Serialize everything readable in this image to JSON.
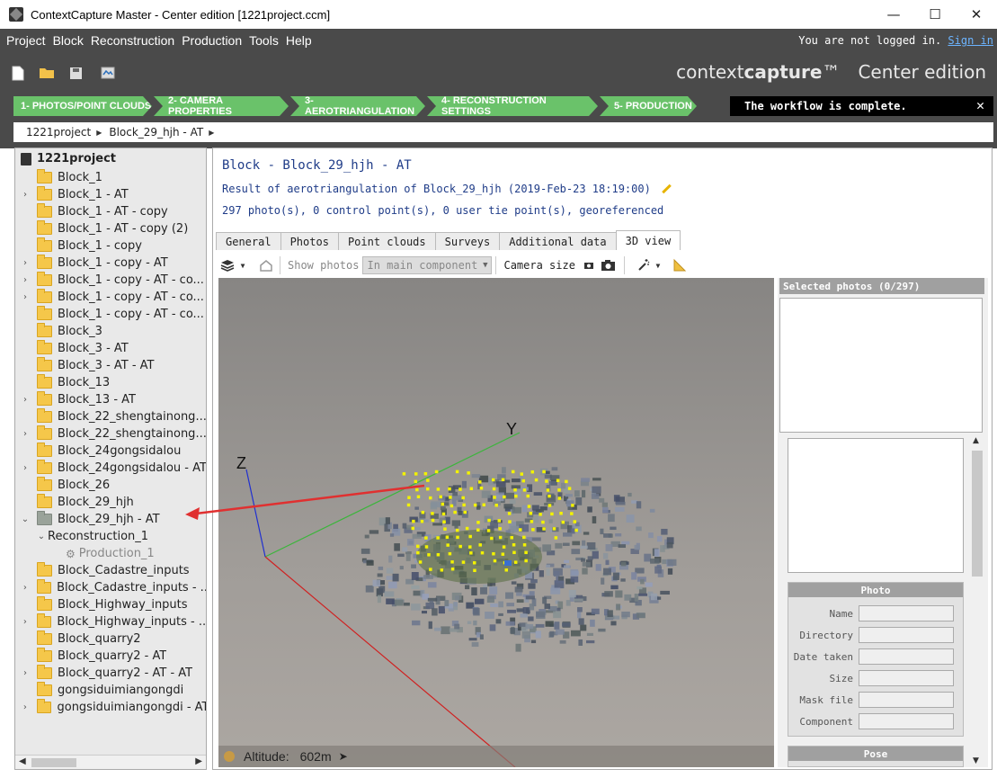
{
  "window": {
    "title": "ContextCapture Master - Center edition [1221project.ccm]",
    "controls": [
      "—",
      "☐",
      "✕"
    ]
  },
  "menu": [
    "Project",
    "Block",
    "Reconstruction",
    "Production",
    "Tools",
    "Help"
  ],
  "login": {
    "text": "You are not logged in.",
    "link": "Sign in"
  },
  "brand": {
    "name_light": "context",
    "name_bold": "capture",
    "tm": "™",
    "edition": "Center edition"
  },
  "workflow": {
    "steps": [
      "1- PHOTOS/POINT CLOUDS",
      "2- CAMERA PROPERTIES",
      "3- AEROTRIANGULATION",
      "4- RECONSTRUCTION SETTINGS",
      "5- PRODUCTION"
    ],
    "message": "The workflow is complete.",
    "close": "✕"
  },
  "breadcrumb": [
    "1221project",
    "Block_29_hjh - AT"
  ],
  "tree": {
    "root": "1221project",
    "items": [
      {
        "label": "Block_1",
        "exp": ""
      },
      {
        "label": "Block_1 - AT",
        "exp": "›"
      },
      {
        "label": "Block_1 - AT - copy",
        "exp": ""
      },
      {
        "label": "Block_1 - AT - copy (2)",
        "exp": ""
      },
      {
        "label": "Block_1 - copy",
        "exp": ""
      },
      {
        "label": "Block_1 - copy - AT",
        "exp": "›"
      },
      {
        "label": "Block_1 - copy - AT - co...",
        "exp": "›"
      },
      {
        "label": "Block_1 - copy - AT - co...",
        "exp": "›"
      },
      {
        "label": "Block_1 - copy - AT - co...",
        "exp": ""
      },
      {
        "label": "Block_3",
        "exp": ""
      },
      {
        "label": "Block_3 - AT",
        "exp": ""
      },
      {
        "label": "Block_3 - AT - AT",
        "exp": ""
      },
      {
        "label": "Block_13",
        "exp": ""
      },
      {
        "label": "Block_13 - AT",
        "exp": "›"
      },
      {
        "label": "Block_22_shengtainong...",
        "exp": ""
      },
      {
        "label": "Block_22_shengtainong...",
        "exp": "›"
      },
      {
        "label": "Block_24gongsidalou",
        "exp": ""
      },
      {
        "label": "Block_24gongsidalou - AT",
        "exp": "›"
      },
      {
        "label": "Block_26",
        "exp": ""
      },
      {
        "label": "Block_29_hjh",
        "exp": ""
      },
      {
        "label": "Block_29_hjh - AT",
        "exp": "⌄"
      },
      {
        "label": "Reconstruction_1",
        "exp": "⌄"
      },
      {
        "label": "Production_1",
        "exp": ""
      },
      {
        "label": "Block_Cadastre_inputs",
        "exp": ""
      },
      {
        "label": "Block_Cadastre_inputs - ...",
        "exp": "›"
      },
      {
        "label": "Block_Highway_inputs",
        "exp": ""
      },
      {
        "label": "Block_Highway_inputs - ...",
        "exp": "›"
      },
      {
        "label": "Block_quarry2",
        "exp": ""
      },
      {
        "label": "Block_quarry2 - AT",
        "exp": ""
      },
      {
        "label": "Block_quarry2 - AT - AT",
        "exp": "›"
      },
      {
        "label": "gongsiduimiangongdi",
        "exp": ""
      },
      {
        "label": "gongsiduimiangongdi - AT",
        "exp": "›"
      }
    ]
  },
  "main": {
    "title": "Block - Block_29_hjh - AT",
    "result": "Result of aerotriangulation of Block_29_hjh (2019-Feb-23 18:19:00)",
    "stats": "297 photo(s), 0 control point(s), 0 user tie point(s), georeferenced",
    "tabs": [
      "General",
      "Photos",
      "Point clouds",
      "Surveys",
      "Additional data",
      "3D view"
    ],
    "active_tab": "3D view"
  },
  "view_toolbar": {
    "show_photos": "Show photos",
    "component_select": "In main component",
    "camera_size": "Camera size"
  },
  "viewport": {
    "axes": {
      "x": "",
      "y": "Y",
      "z": "Z"
    },
    "altitude_label": "Altitude:",
    "altitude_value": "602m",
    "colors": {
      "y_axis": "#3cb53c",
      "z_axis": "#2030d0",
      "x_axis": "#d02020",
      "points": "#f2f200",
      "arrow": "#e03030"
    }
  },
  "right_panel": {
    "selected_header": "Selected photos (0/297)",
    "photo_group": "Photo",
    "fields": [
      "Name",
      "Directory",
      "Date taken",
      "Size",
      "Mask file",
      "Component"
    ],
    "pose_group": "Pose"
  }
}
